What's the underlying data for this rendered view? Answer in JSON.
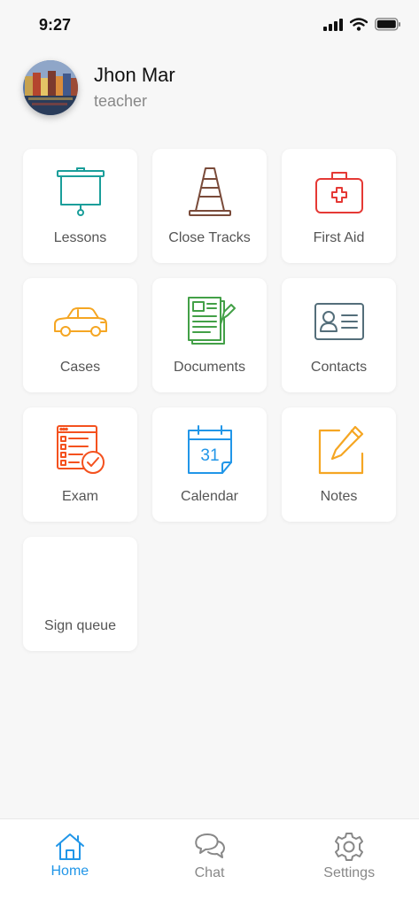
{
  "status_bar": {
    "time": "9:27"
  },
  "profile": {
    "name": "Jhon Mar",
    "role": "teacher"
  },
  "tiles": [
    {
      "label": "Lessons",
      "icon": "presentation-board-icon",
      "color": "#1a9e9a"
    },
    {
      "label": "Close Tracks",
      "icon": "traffic-cone-icon",
      "color": "#7a4b3a"
    },
    {
      "label": "First Aid",
      "icon": "first-aid-kit-icon",
      "color": "#e53935"
    },
    {
      "label": "Cases",
      "icon": "car-icon",
      "color": "#f5a623"
    },
    {
      "label": "Documents",
      "icon": "document-icon",
      "color": "#43a047"
    },
    {
      "label": "Contacts",
      "icon": "contact-card-icon",
      "color": "#546e7a"
    },
    {
      "label": "Exam",
      "icon": "exam-checklist-icon",
      "color": "#f4511e"
    },
    {
      "label": "Calendar",
      "icon": "calendar-icon",
      "color": "#2196e8",
      "day": "31"
    },
    {
      "label": "Notes",
      "icon": "note-edit-icon",
      "color": "#f5a623"
    },
    {
      "label": "Sign queue",
      "icon": "",
      "color": ""
    }
  ],
  "bottom_nav": [
    {
      "label": "Home",
      "icon": "home-icon",
      "active": true
    },
    {
      "label": "Chat",
      "icon": "chat-icon",
      "active": false
    },
    {
      "label": "Settings",
      "icon": "gear-icon",
      "active": false
    }
  ],
  "colors": {
    "accent": "#2196e8",
    "background": "#f7f7f7",
    "inactive": "#888888"
  }
}
